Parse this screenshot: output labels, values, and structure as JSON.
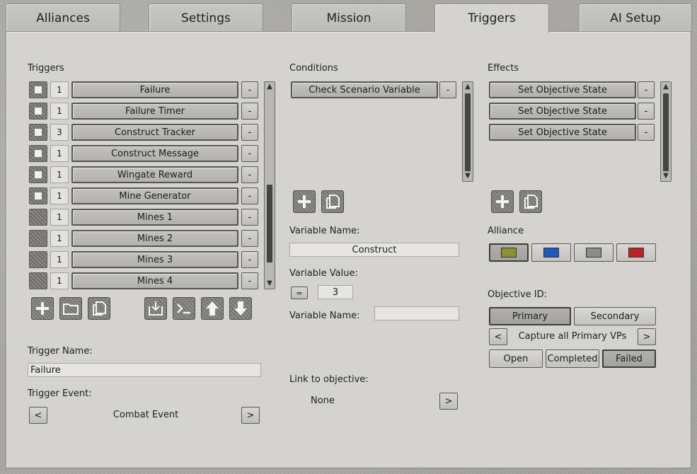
{
  "tabs": [
    {
      "label": "Alliances"
    },
    {
      "label": "Settings"
    },
    {
      "label": "Mission"
    },
    {
      "label": "Triggers"
    },
    {
      "label": "AI Setup"
    }
  ],
  "triggers": {
    "title": "Triggers",
    "items": [
      {
        "num": "1",
        "label": "Failure",
        "checkbox": true
      },
      {
        "num": "1",
        "label": "Failure Timer",
        "checkbox": true
      },
      {
        "num": "3",
        "label": "Construct Tracker",
        "checkbox": true
      },
      {
        "num": "1",
        "label": "Construct Message",
        "checkbox": true
      },
      {
        "num": "1",
        "label": "Wingate Reward",
        "checkbox": true
      },
      {
        "num": "1",
        "label": "Mine Generator",
        "checkbox": true
      },
      {
        "num": "1",
        "label": "Mines 1",
        "checkbox": false
      },
      {
        "num": "1",
        "label": "Mines 2",
        "checkbox": false
      },
      {
        "num": "1",
        "label": "Mines 3",
        "checkbox": false
      },
      {
        "num": "1",
        "label": "Mines 4",
        "checkbox": false
      }
    ],
    "remove_label": "-",
    "name_label": "Trigger Name:",
    "name_value": "Failure",
    "event_label": "Trigger Event:",
    "event_value": "Combat Event",
    "prev": "<",
    "next": ">"
  },
  "conditions": {
    "title": "Conditions",
    "items": [
      {
        "label": "Check Scenario Variable"
      }
    ],
    "remove_label": "-",
    "var_name_label": "Variable Name:",
    "var_name_value": "Construct",
    "var_value_label": "Variable Value:",
    "op": "=",
    "var_value": "3",
    "var_name2_label": "Variable Name:",
    "var_name2_value": "",
    "link_label": "Link to objective:",
    "link_value": "None",
    "link_next": ">"
  },
  "effects": {
    "title": "Effects",
    "items": [
      {
        "label": "Set Objective State"
      },
      {
        "label": "Set Objective State"
      },
      {
        "label": "Set Objective State"
      }
    ],
    "remove_label": "-",
    "alliance_label": "Alliance",
    "alliance_colors": [
      "#8d9230",
      "#1c5bbf",
      "#8c8c8c",
      "#bf2222"
    ],
    "objective_label": "Objective ID:",
    "primary": "Primary",
    "secondary": "Secondary",
    "objective_prev": "<",
    "objective_value": "Capture all Primary VPs",
    "objective_next": ">",
    "open": "Open",
    "completed": "Completed",
    "failed": "Failed"
  }
}
